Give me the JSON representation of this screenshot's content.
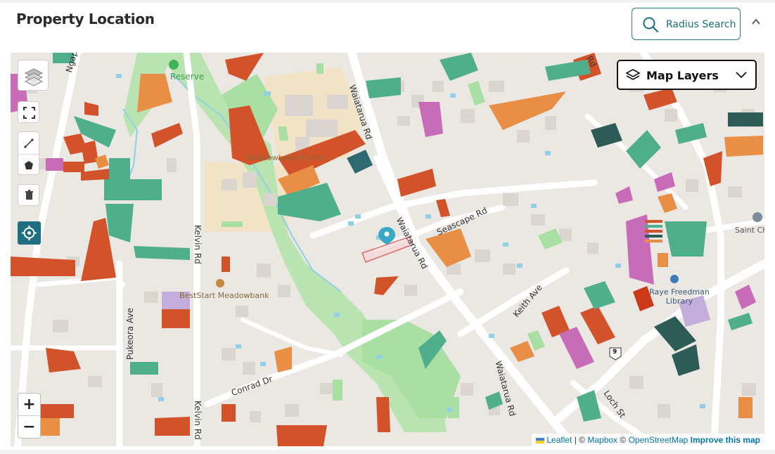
{
  "header": {
    "title": "Property Location",
    "radius_search_label": "Radius Search"
  },
  "map": {
    "layers_label": "Map Layers",
    "streets": [
      "Ngapuhi Rd",
      "Waiatarua Rd",
      "Seascape Rd",
      "Waiatarua Rd",
      "Kelvin Rd",
      "Kelvin Rd",
      "Pukeora Ave",
      "Conrad Dr",
      "Keith Ave",
      "Waiatarua Rd",
      "Loch St",
      "Rd"
    ],
    "pois": [
      "Reserve",
      "Meadowbank School",
      "BestStart Meadowbank",
      "Raye Freedman Library",
      "Saint Chad's Anglican Church"
    ],
    "route_shield": "9",
    "zoom_in": "+",
    "zoom_out": "−",
    "attribution": {
      "leaflet": "Leaflet",
      "separator1": " | © ",
      "mapbox": "Mapbox",
      "separator2": " © ",
      "osm": "OpenStreetMap",
      "improve": "Improve this map"
    },
    "colors": {
      "red": "#d2532a",
      "orange": "#e98f45",
      "teal": "#4fae8c",
      "dark_teal": "#2d5b55",
      "magenta": "#c86cb8",
      "lavender": "#c3aedb",
      "park": "#a9dfa3",
      "school": "#f2e3c6",
      "marker": "#3aa9c8"
    }
  }
}
